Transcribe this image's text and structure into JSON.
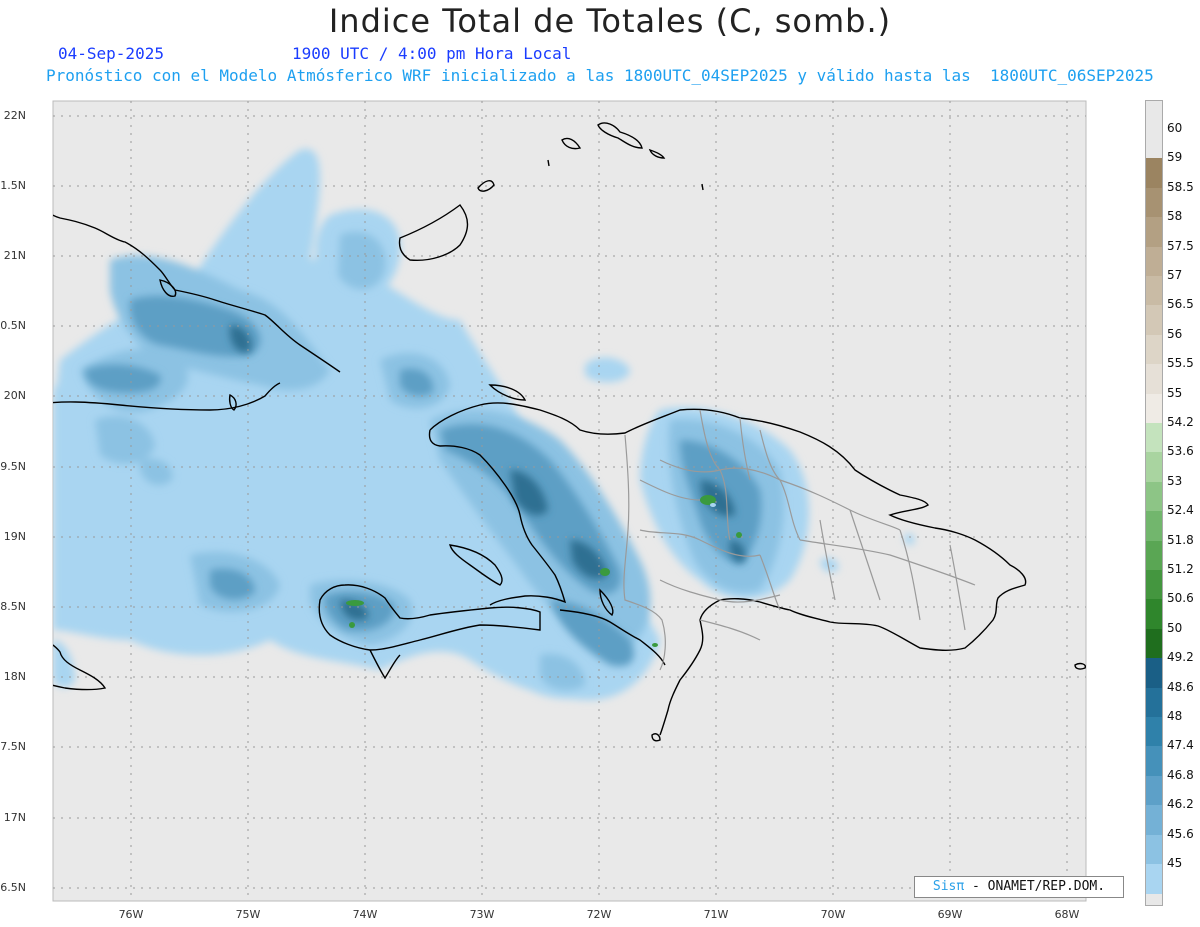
{
  "header": {
    "title": "Indice Total de Totales (C, somb.)",
    "date": "04-Sep-2025",
    "time": "1900 UTC / 4:00 pm Hora Local",
    "forecast": "Pronóstico con el Modelo Atmósferico WRF inicializado a las 1800UTC_04SEP2025 y válido hasta las  1800UTC_06SEP2025"
  },
  "axes": {
    "lat_labels": [
      "22N",
      "1.5N",
      "21N",
      "0.5N",
      "20N",
      "9.5N",
      "19N",
      "8.5N",
      "18N",
      "7.5N",
      "17N",
      "6.5N"
    ],
    "lon_labels": [
      "76W",
      "75W",
      "74W",
      "73W",
      "72W",
      "71W",
      "70W",
      "69W",
      "68W"
    ]
  },
  "colorbar": {
    "labels": [
      "60",
      "59",
      "58.5",
      "58",
      "57.5",
      "57",
      "56.5",
      "56",
      "55.5",
      "55",
      "54.2",
      "53.6",
      "53",
      "52.4",
      "51.8",
      "51.2",
      "50.6",
      "50",
      "49.2",
      "48.6",
      "48",
      "47.4",
      "46.8",
      "46.2",
      "45.6",
      "45"
    ],
    "colors": [
      "#e8e8e8",
      "#9b8461",
      "#a79272",
      "#b3a083",
      "#bfae95",
      "#c9bba5",
      "#d3c8b6",
      "#ddd5c7",
      "#e6e0d7",
      "#efebe5",
      "#c4e3bd",
      "#a9d4a0",
      "#8dc586",
      "#72b66d",
      "#5aa654",
      "#44963f",
      "#2f862c",
      "#1f6e1e",
      "#1a5f86",
      "#24719a",
      "#2f81aa",
      "#4591ba",
      "#5da0c8",
      "#74b1d6",
      "#8cc2e3",
      "#a9d5f1"
    ]
  },
  "credit": {
    "logo": "Sisπ",
    "text": " - ONAMET/REP.DOM."
  }
}
